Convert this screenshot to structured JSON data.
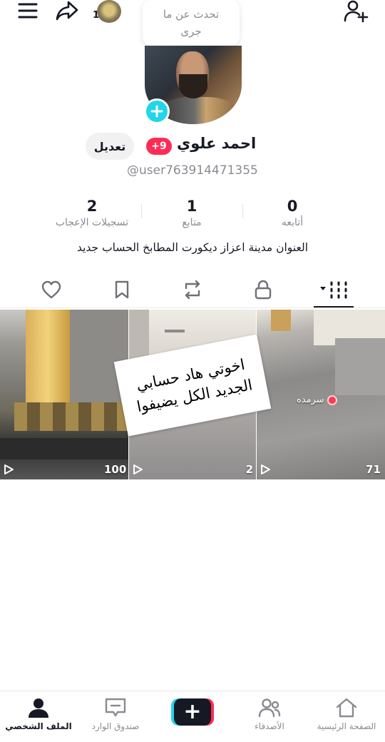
{
  "header": {
    "story_count": "1",
    "bubble_text": "تحدث عن ما جرى"
  },
  "profile": {
    "name": "احمد علوي",
    "notification_badge": "+9",
    "edit_label": "تعديل",
    "username": "@user763914471355",
    "bio": "العنوان مدينة اعزاز ديكورت المطابخ الحساب جديد"
  },
  "stats": [
    {
      "value": "0",
      "label": "أتابعه"
    },
    {
      "value": "1",
      "label": "متابع"
    },
    {
      "value": "2",
      "label": "تسجيلات الإعجاب"
    }
  ],
  "tabs": [
    {
      "icon": "grid-icon",
      "active": true
    },
    {
      "icon": "lock-icon"
    },
    {
      "icon": "repost-icon"
    },
    {
      "icon": "bookmark-icon"
    },
    {
      "icon": "heart-icon"
    }
  ],
  "videos": [
    {
      "views": "100"
    },
    {
      "views": "2"
    },
    {
      "views": "71"
    }
  ],
  "overlay": {
    "sticker_line1": "اخوتي هاد حسابي",
    "sticker_line2": "الجديد الكل يضيفوا",
    "location_tag": "سرمده"
  },
  "bottom_nav": {
    "home": "الصفحة الرئيسية",
    "friends": "الأصدقاء",
    "create": "+",
    "inbox": "صندوق الوارد",
    "profile": "الملف الشخصي"
  },
  "colors": {
    "accent_pink": "#fe2c55",
    "accent_cyan": "#20d5ec",
    "text_dark": "#161823",
    "text_gray": "#8a8b91"
  }
}
